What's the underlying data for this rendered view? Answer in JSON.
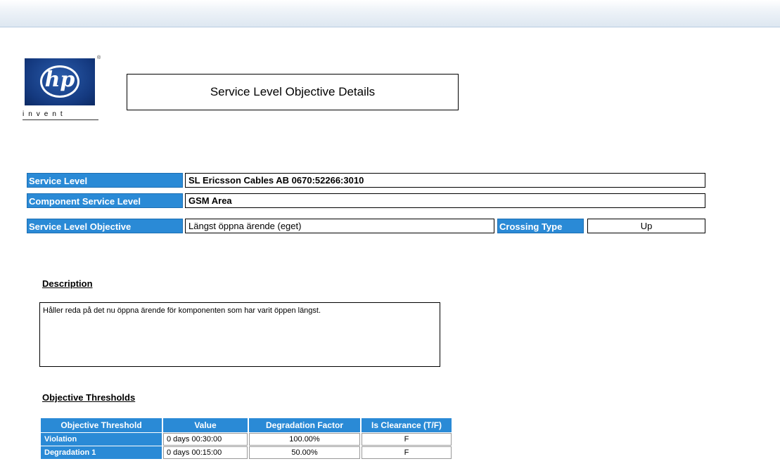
{
  "header": {
    "title": "Service Level Objective Details",
    "logo_text": "hp",
    "logo_tagline": "invent",
    "logo_mark": "®"
  },
  "info": {
    "service_level": {
      "label": "Service Level",
      "value": "SL Ericsson Cables AB 0670:52266:3010"
    },
    "component_service_level": {
      "label": "Component Service Level",
      "value": "GSM Area"
    },
    "service_level_objective": {
      "label": "Service Level Objective",
      "value": "Längst öppna ärende (eget)"
    },
    "crossing_type": {
      "label": "Crossing Type",
      "value": "Up"
    }
  },
  "description": {
    "heading": "Description",
    "text": "Håller reda på det nu öppna ärende för komponenten  som har varit öppen längst."
  },
  "thresholds": {
    "heading": "Objective Thresholds",
    "columns": [
      "Objective Threshold",
      "Value",
      "Degradation Factor",
      "Is Clearance (T/F)"
    ],
    "rows": [
      {
        "name": "Violation",
        "value": "0 days 00:30:00",
        "factor": "100.00%",
        "clearance": "F"
      },
      {
        "name": "Degradation 1",
        "value": "0 days 00:15:00",
        "factor": "50.00%",
        "clearance": "F"
      }
    ]
  },
  "colors": {
    "label_bg": "#2a8ad6",
    "logo_blue": "#14397f"
  }
}
